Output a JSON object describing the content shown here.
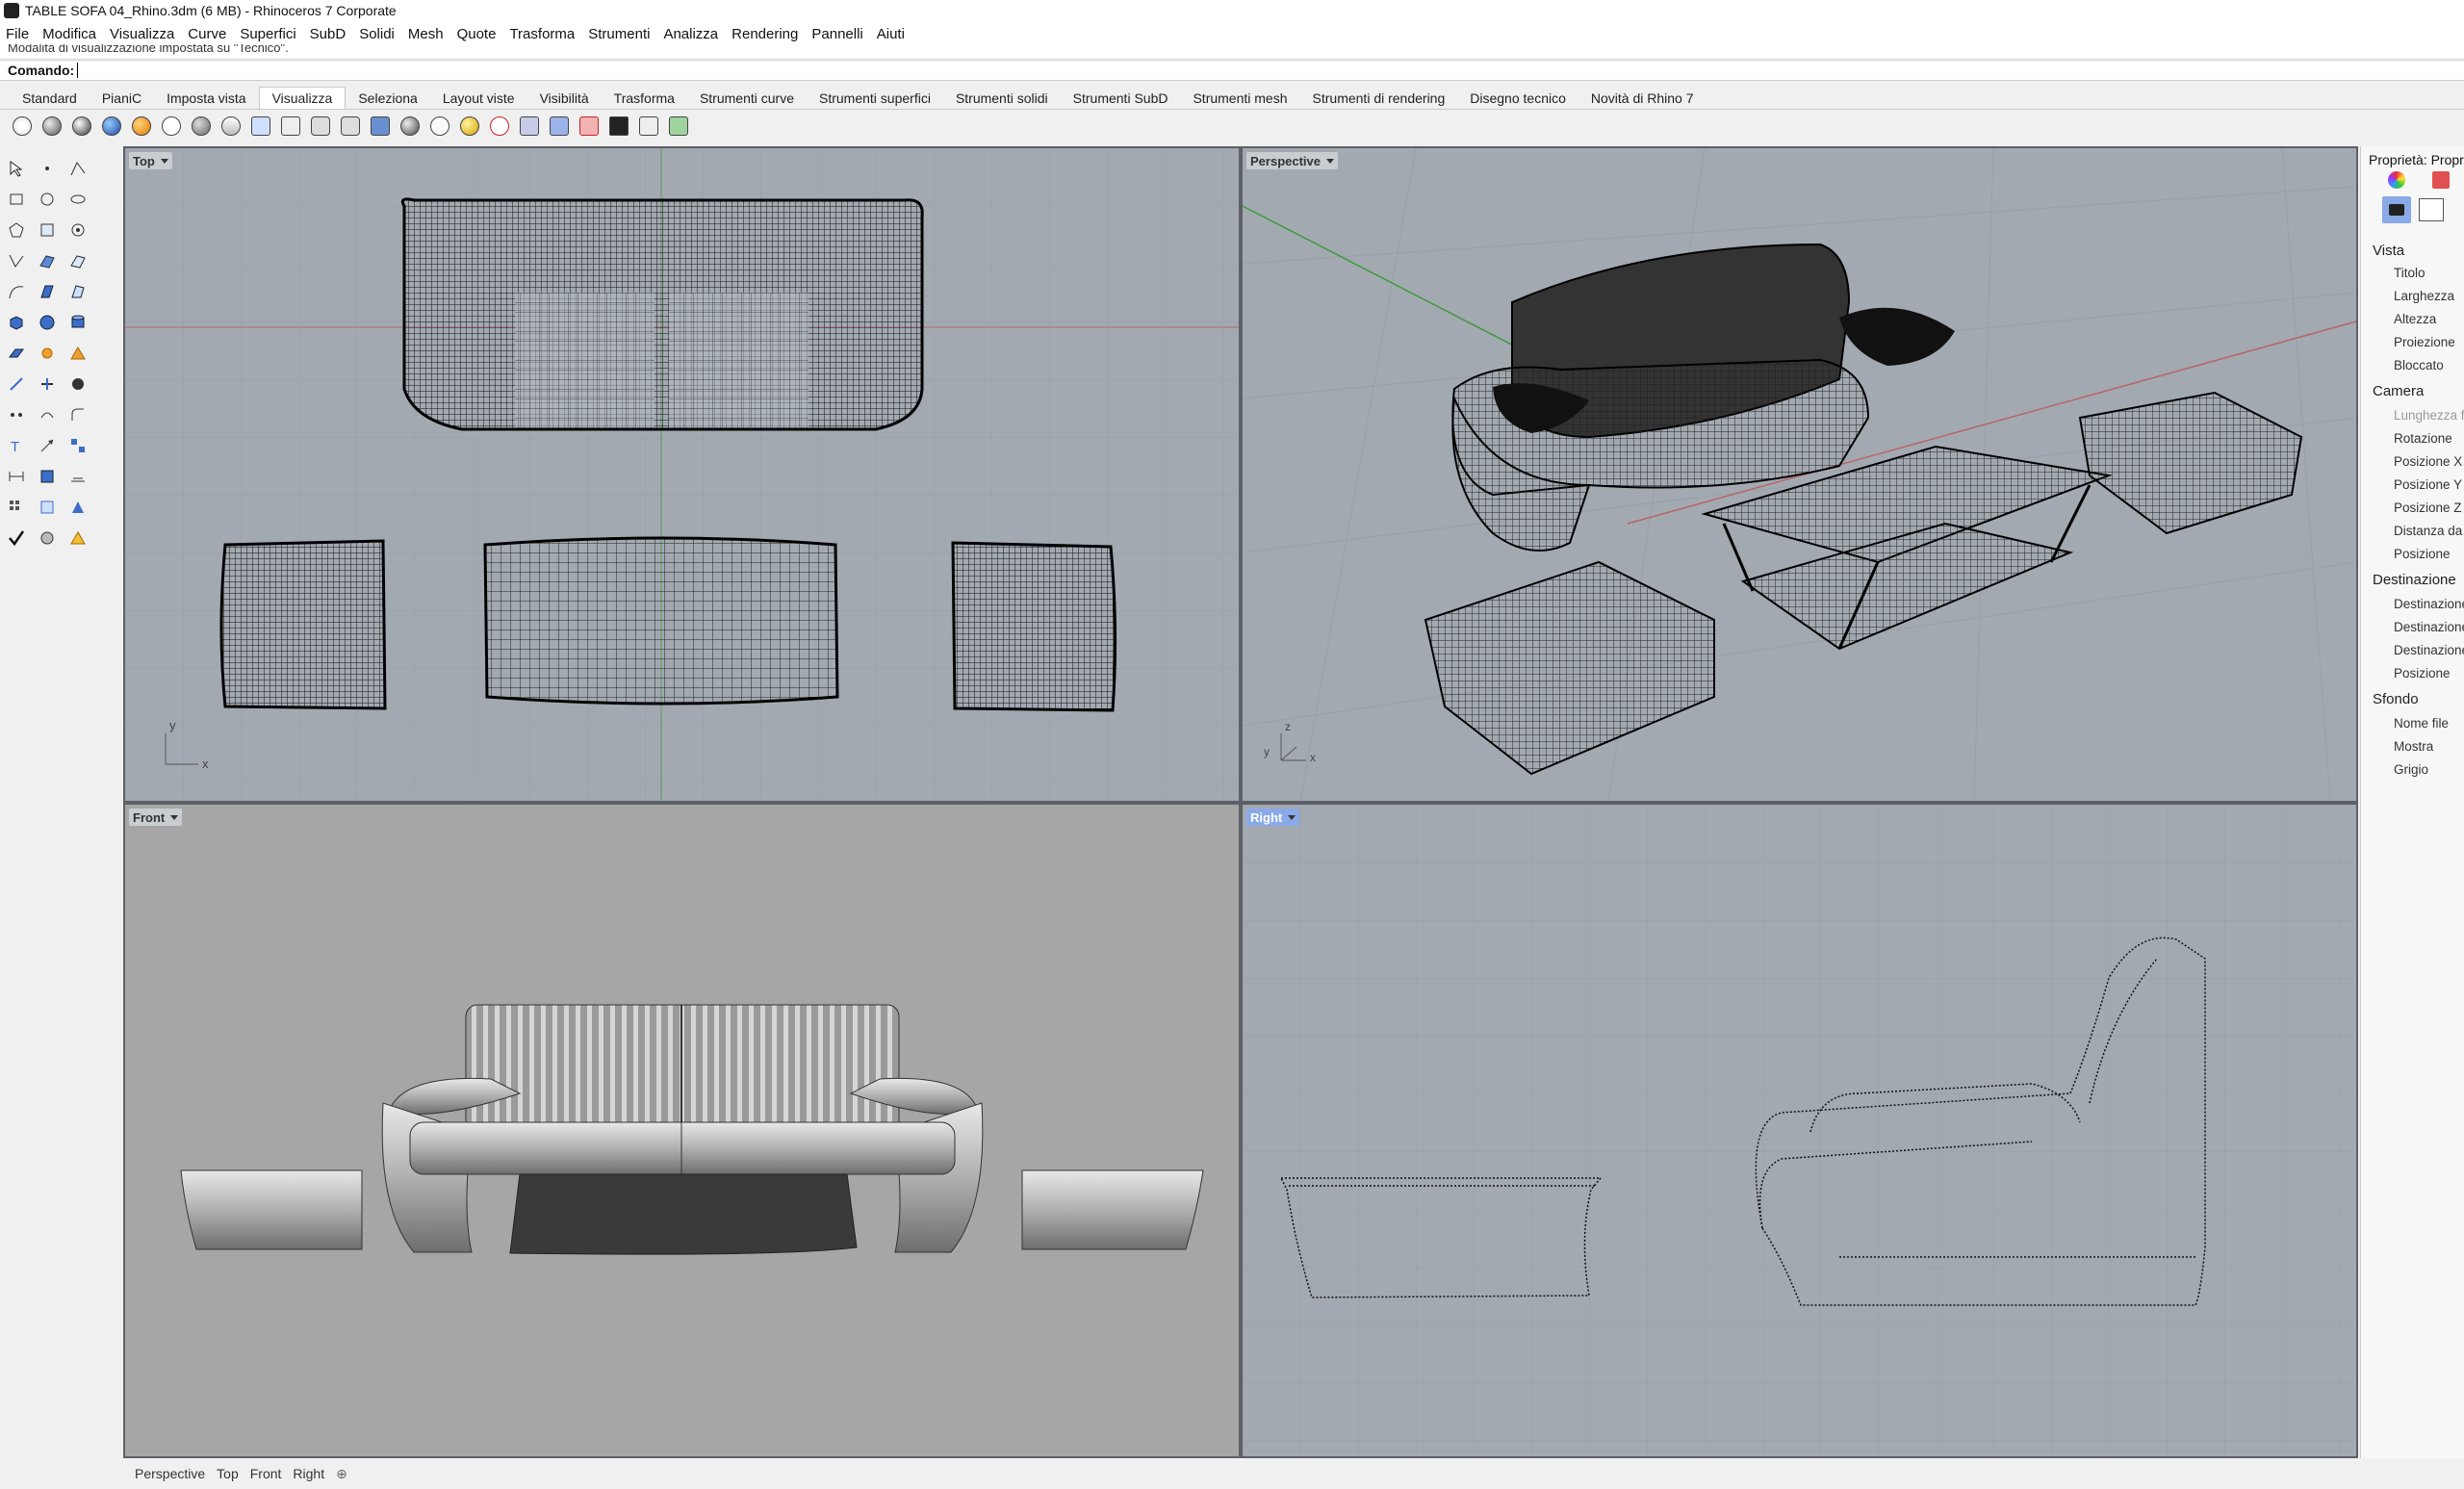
{
  "window": {
    "title": "TABLE SOFA 04_Rhino.3dm (6 MB) - Rhinoceros 7 Corporate"
  },
  "menu": [
    "File",
    "Modifica",
    "Visualizza",
    "Curve",
    "Superfici",
    "SubD",
    "Solidi",
    "Mesh",
    "Quote",
    "Trasforma",
    "Strumenti",
    "Analizza",
    "Rendering",
    "Pannelli",
    "Aiuti"
  ],
  "command": {
    "history": "Modalità di visualizzazione impostata su \"Tecnico\".",
    "prompt": "Comando:"
  },
  "tabs": [
    "Standard",
    "PianiC",
    "Imposta vista",
    "Visualizza",
    "Seleziona",
    "Layout viste",
    "Visibilità",
    "Trasforma",
    "Strumenti curve",
    "Strumenti superfici",
    "Strumenti solidi",
    "Strumenti SubD",
    "Strumenti mesh",
    "Strumenti di rendering",
    "Disegno tecnico",
    "Novità di Rhino 7"
  ],
  "active_tab": "Visualizza",
  "viewports": {
    "top": {
      "label": "Top",
      "axes": {
        "y": "y",
        "x": "x"
      }
    },
    "perspective": {
      "label": "Perspective",
      "axes": {
        "z": "z",
        "y": "y",
        "x": "x"
      }
    },
    "front": {
      "label": "Front"
    },
    "right": {
      "label": "Right",
      "active": true
    }
  },
  "bottom_tabs": [
    "Perspective",
    "Top",
    "Front",
    "Right"
  ],
  "properties": {
    "title": "Proprietà: Propri",
    "sections": [
      {
        "name": "Vista",
        "items": [
          "Titolo",
          "Larghezza",
          "Altezza",
          "Proiezione",
          "Bloccato"
        ]
      },
      {
        "name": "Camera",
        "items": [
          "Lunghezza f",
          "Rotazione",
          "Posizione X",
          "Posizione Y",
          "Posizione Z",
          "Distanza da",
          "Posizione"
        ]
      },
      {
        "name": "Destinazione",
        "items": [
          "Destinazione",
          "Destinazione",
          "Destinazione",
          "Posizione"
        ]
      },
      {
        "name": "Sfondo",
        "items": [
          "Nome file",
          "Mostra",
          "Grigio"
        ]
      }
    ]
  },
  "colors": {
    "viewport_bg": "#a3a9b1",
    "front_bg": "#a6a6a6",
    "active_label": "#8aa9e8",
    "x_axis": "#c05050",
    "y_axis": "#3f9a3f"
  }
}
